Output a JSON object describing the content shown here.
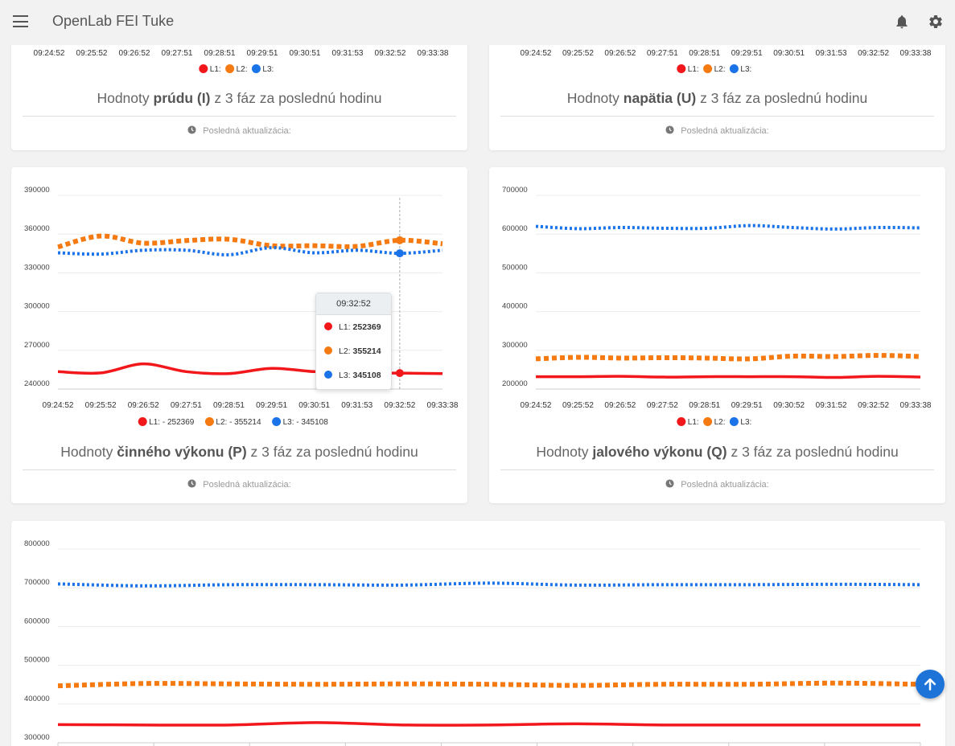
{
  "app": {
    "title": "OpenLab FEI Tuke"
  },
  "icons": [
    "menu-icon",
    "bell-icon",
    "gear-icon",
    "clock-icon",
    "arrow-up-icon"
  ],
  "colors": {
    "L1": "#f2171b",
    "L2": "#f57a12",
    "L3": "#1a73e8",
    "fab": "#1e73d8"
  },
  "footer_label": "Posledná aktualizácia:",
  "cards": {
    "current": {
      "title_pre": "Hodnoty ",
      "title_bold": "prúdu (I)",
      "title_post": " z 3 fáz za poslednú hodinu"
    },
    "voltage": {
      "title_pre": "Hodnoty ",
      "title_bold": "napätia (U)",
      "title_post": " z 3 fáz za poslednú hodinu"
    },
    "active": {
      "title_pre": "Hodnoty ",
      "title_bold": "činného výkonu (P)",
      "title_post": " z 3 fáz za poslednú hodinu"
    },
    "reactive": {
      "title_pre": "Hodnoty ",
      "title_bold": "jalového výkonu (Q)",
      "title_post": " z 3 fáz za poslednú hodinu"
    }
  },
  "tooltip": {
    "time": "09:32:52",
    "rows": [
      {
        "label": "L1:",
        "value": "252369"
      },
      {
        "label": "L2:",
        "value": "355214"
      },
      {
        "label": "L3:",
        "value": "345108"
      }
    ]
  },
  "chart_data": [
    {
      "id": "current",
      "type": "line",
      "x": [
        "09:24:52",
        "09:25:52",
        "09:26:52",
        "09:27:51",
        "09:28:51",
        "09:29:51",
        "09:30:51",
        "09:31:53",
        "09:32:52",
        "09:33:38"
      ],
      "legend": [
        "L1:",
        "L2:",
        "L3:"
      ],
      "series": [
        {
          "name": "L1"
        },
        {
          "name": "L2"
        },
        {
          "name": "L3"
        }
      ]
    },
    {
      "id": "voltage",
      "type": "line",
      "x": [
        "09:24:52",
        "09:25:52",
        "09:26:52",
        "09:27:51",
        "09:28:51",
        "09:29:51",
        "09:30:51",
        "09:31:53",
        "09:32:52",
        "09:33:38"
      ],
      "legend": [
        "L1:",
        "L2:",
        "L3:"
      ],
      "series": [
        {
          "name": "L1"
        },
        {
          "name": "L2"
        },
        {
          "name": "L3"
        }
      ]
    },
    {
      "id": "active",
      "type": "line",
      "x": [
        "09:24:52",
        "09:25:52",
        "09:26:52",
        "09:27:51",
        "09:28:51",
        "09:29:51",
        "09:30:51",
        "09:31:53",
        "09:32:52",
        "09:33:38"
      ],
      "ylim": [
        240000,
        390000
      ],
      "yticks": [
        390000,
        360000,
        330000,
        300000,
        270000,
        240000
      ],
      "legend": [
        "L1: - 252369",
        "L2: - 355214",
        "L3: - 345108"
      ],
      "series": [
        {
          "name": "L1",
          "style": "solid",
          "values": [
            [
              0,
              253500
            ],
            [
              1,
              252500
            ],
            [
              2,
              259500
            ],
            [
              3,
              253500
            ],
            [
              4,
              252000
            ],
            [
              5,
              256000
            ],
            [
              6,
              253500
            ],
            [
              7,
              252500
            ],
            [
              8,
              252369
            ],
            [
              9,
              252000
            ]
          ]
        },
        {
          "name": "L2",
          "style": "dashed-thick",
          "values": [
            [
              0,
              350000
            ],
            [
              1,
              358500
            ],
            [
              2,
              353000
            ],
            [
              3,
              355000
            ],
            [
              4,
              356000
            ],
            [
              5,
              351000
            ],
            [
              6,
              351000
            ],
            [
              7,
              350500
            ],
            [
              8,
              355214
            ],
            [
              9,
              352500
            ]
          ]
        },
        {
          "name": "L3",
          "style": "dotted",
          "values": [
            [
              0,
              345500
            ],
            [
              1,
              344500
            ],
            [
              2,
              347500
            ],
            [
              3,
              347500
            ],
            [
              4,
              344000
            ],
            [
              5,
              349500
            ],
            [
              6,
              345500
            ],
            [
              7,
              347500
            ],
            [
              8,
              345108
            ],
            [
              9,
              347500
            ]
          ]
        }
      ],
      "highlight_index": 8
    },
    {
      "id": "reactive",
      "type": "line",
      "x": [
        "09:24:52",
        "09:25:52",
        "09:26:52",
        "09:27:52",
        "09:28:51",
        "09:29:51",
        "09:30:52",
        "09:31:52",
        "09:32:52",
        "09:33:38"
      ],
      "ylim": [
        200000,
        700000
      ],
      "yticks": [
        700000,
        600000,
        500000,
        400000,
        300000,
        200000
      ],
      "legend": [
        "L1:",
        "L2:",
        "L3:"
      ],
      "series": [
        {
          "name": "L1",
          "style": "solid",
          "values": [
            [
              0,
              232000
            ],
            [
              1,
              232000
            ],
            [
              2,
              233000
            ],
            [
              3,
              231000
            ],
            [
              4,
              232000
            ],
            [
              5,
              232000
            ],
            [
              6,
              232000
            ],
            [
              7,
              230000
            ],
            [
              8,
              233000
            ],
            [
              9,
              231000
            ]
          ]
        },
        {
          "name": "L2",
          "style": "dashed-thick",
          "values": [
            [
              0,
              278000
            ],
            [
              1,
              282000
            ],
            [
              2,
              280000
            ],
            [
              3,
              281000
            ],
            [
              4,
              280000
            ],
            [
              5,
              278000
            ],
            [
              6,
              285000
            ],
            [
              7,
              284000
            ],
            [
              8,
              287000
            ],
            [
              9,
              284000
            ]
          ]
        },
        {
          "name": "L3",
          "style": "dotted",
          "values": [
            [
              0,
              620000
            ],
            [
              1,
              614000
            ],
            [
              2,
              617000
            ],
            [
              3,
              615000
            ],
            [
              4,
              615000
            ],
            [
              5,
              622000
            ],
            [
              6,
              617000
            ],
            [
              7,
              613000
            ],
            [
              8,
              617000
            ],
            [
              9,
              616000
            ]
          ]
        }
      ]
    },
    {
      "id": "apparent",
      "type": "line",
      "ylim": [
        300000,
        800000
      ],
      "yticks": [
        800000,
        700000,
        600000,
        500000,
        400000,
        300000
      ],
      "series": [
        {
          "name": "L1",
          "style": "solid",
          "values": [
            [
              0,
              347000
            ],
            [
              1,
              346000
            ],
            [
              2,
              346000
            ],
            [
              3,
              352000
            ],
            [
              4,
              346000
            ],
            [
              5,
              346000
            ],
            [
              6,
              349000
            ],
            [
              7,
              346000
            ],
            [
              8,
              346000
            ],
            [
              9,
              346000
            ],
            [
              10,
              346000
            ]
          ]
        },
        {
          "name": "L2",
          "style": "dashed-thick",
          "values": [
            [
              0,
              447000
            ],
            [
              1,
              453000
            ],
            [
              2,
              452000
            ],
            [
              3,
              451000
            ],
            [
              4,
              452000
            ],
            [
              5,
              451000
            ],
            [
              6,
              448000
            ],
            [
              7,
              451000
            ],
            [
              8,
              451000
            ],
            [
              9,
              454000
            ],
            [
              10,
              451000
            ]
          ]
        },
        {
          "name": "L3",
          "style": "dotted",
          "values": [
            [
              0,
              710000
            ],
            [
              1,
              705000
            ],
            [
              2,
              708000
            ],
            [
              3,
              708000
            ],
            [
              4,
              707000
            ],
            [
              5,
              712000
            ],
            [
              6,
              707000
            ],
            [
              7,
              708000
            ],
            [
              8,
              708000
            ],
            [
              9,
              709000
            ],
            [
              10,
              708000
            ]
          ]
        }
      ]
    }
  ]
}
